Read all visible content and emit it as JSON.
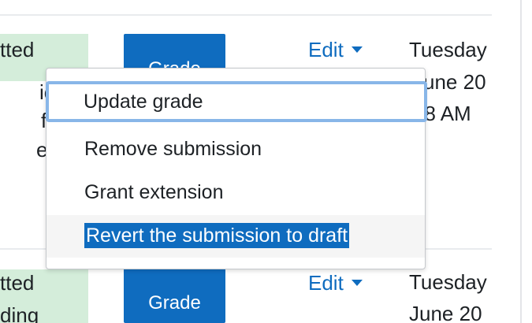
{
  "rows": [
    {
      "status_lines": [
        "tted",
        "ic",
        "f",
        "e"
      ],
      "grade_label": "Grade",
      "edit_label": "Edit",
      "date_lines": [
        "Tuesday",
        "June 20",
        "48 AM"
      ]
    },
    {
      "status_lines": [
        "tted",
        "ding"
      ],
      "grade_label": "Grade",
      "edit_label": "Edit",
      "date_lines": [
        "Tuesday",
        "June 20"
      ]
    }
  ],
  "menu": {
    "items": [
      {
        "label": "Update grade",
        "state": "focused"
      },
      {
        "label": "Remove submission",
        "state": "normal"
      },
      {
        "label": "Grant extension",
        "state": "normal"
      },
      {
        "label": "Revert the submission to draft",
        "state": "selected"
      }
    ]
  },
  "colors": {
    "primary": "#0f6cbf",
    "status_bg": "#d4edda",
    "focus_ring": "#88b6e8"
  }
}
